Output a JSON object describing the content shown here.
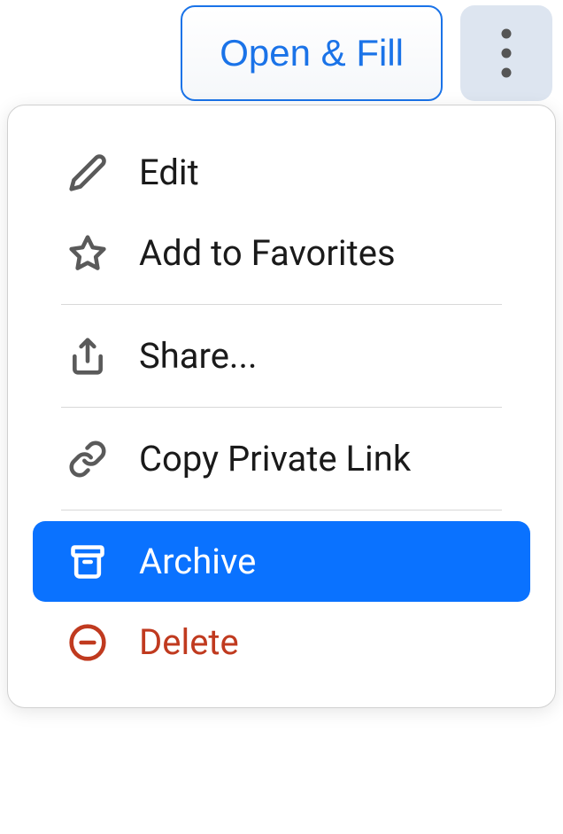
{
  "toolbar": {
    "open_fill_label": "Open & Fill"
  },
  "menu": {
    "edit": "Edit",
    "favorites": "Add to Favorites",
    "share": "Share...",
    "copy_link": "Copy Private Link",
    "archive": "Archive",
    "delete": "Delete"
  }
}
